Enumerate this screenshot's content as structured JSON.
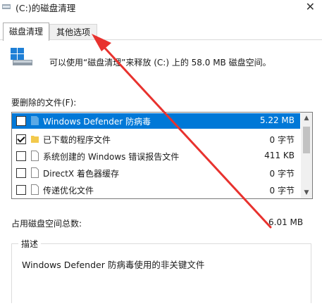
{
  "window": {
    "title": "(C:)的磁盘清理"
  },
  "tabs": [
    {
      "label": "磁盘清理",
      "active": true
    },
    {
      "label": "其他选项",
      "active": false
    }
  ],
  "info_text": "可以使用“磁盘清理”来释放 (C:) 上的 58.0 MB 磁盘空间。",
  "files_label": "要删除的文件(F):",
  "files": [
    {
      "name": "Windows Defender 防病毒",
      "size": "5.22 MB",
      "checked": false,
      "selected": true,
      "icon": "folder-blue-icon"
    },
    {
      "name": "已下载的程序文件",
      "size": "0 字节",
      "checked": true,
      "selected": false,
      "icon": "folder-yellow-icon"
    },
    {
      "name": "系统创建的 Windows 错误报告文件",
      "size": "411 KB",
      "checked": false,
      "selected": false,
      "icon": "file-icon"
    },
    {
      "name": "DirectX 着色器缓存",
      "size": "0 字节",
      "checked": false,
      "selected": false,
      "icon": "file-icon"
    },
    {
      "name": "传递优化文件",
      "size": "0 字节",
      "checked": false,
      "selected": false,
      "icon": "file-icon"
    }
  ],
  "total": {
    "label": "占用磁盘空间总数:",
    "value": "6.01 MB"
  },
  "description": {
    "legend": "描述",
    "text": "Windows Defender 防病毒使用的非关键文件"
  },
  "colors": {
    "selection": "#0078d7",
    "annotation_arrow": "#e8322e"
  }
}
